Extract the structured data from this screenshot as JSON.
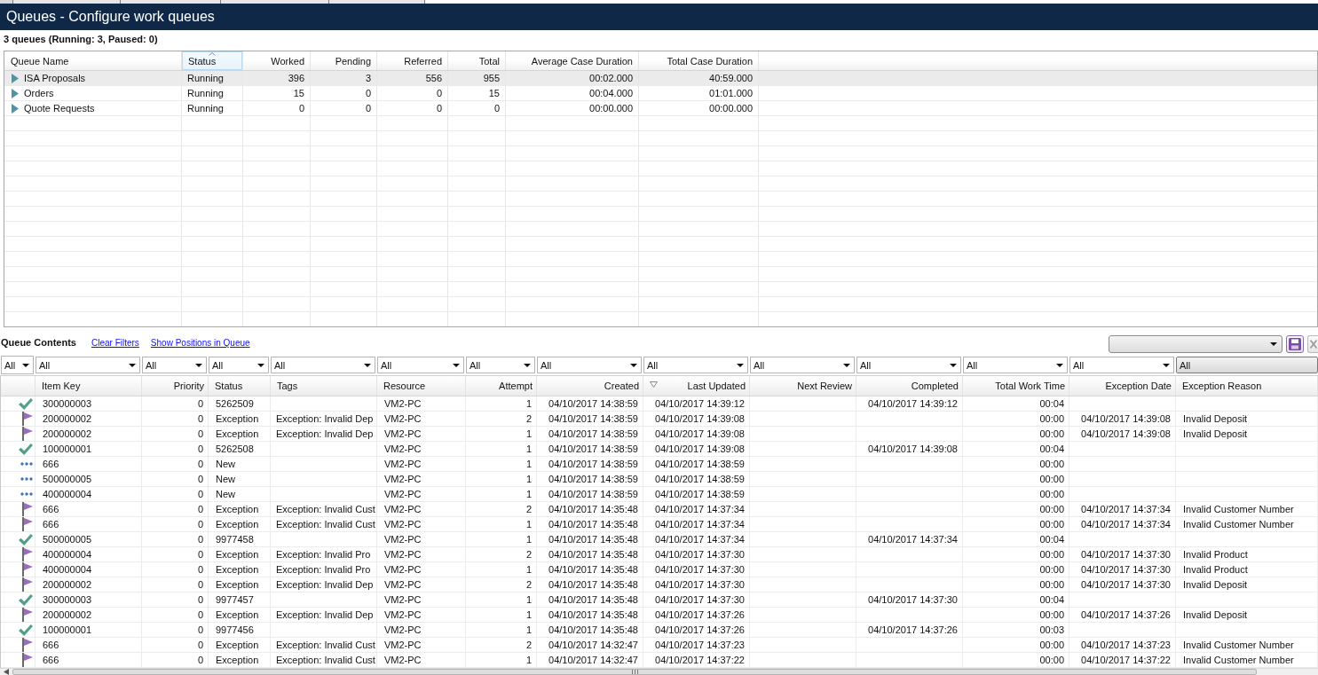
{
  "window": {
    "title": "Queues - Configure work queues"
  },
  "summary": "3 queues (Running: 3, Paused: 0)",
  "queues_table": {
    "columns": [
      {
        "label": "Queue Name",
        "kind": "text",
        "sort_ascending": false,
        "sort_descending": false
      },
      {
        "label": "Status",
        "kind": "text",
        "sort_ascending": true,
        "sort_descending": false
      },
      {
        "label": "Worked",
        "kind": "number",
        "sort_ascending": false,
        "sort_descending": false
      },
      {
        "label": "Pending",
        "kind": "number",
        "sort_ascending": false,
        "sort_descending": false
      },
      {
        "label": "Referred",
        "kind": "number",
        "sort_ascending": false,
        "sort_descending": false
      },
      {
        "label": "Total",
        "kind": "number",
        "sort_ascending": false,
        "sort_descending": false
      },
      {
        "label": "Average Case Duration",
        "kind": "time",
        "sort_ascending": false,
        "sort_descending": false
      },
      {
        "label": "Total Case Duration",
        "kind": "time",
        "sort_ascending": false,
        "sort_descending": false
      }
    ],
    "rows": [
      {
        "selected": true,
        "expanded": false,
        "cells": [
          "ISA Proposals",
          "Running",
          "396",
          "3",
          "556",
          "955",
          "00:02.000",
          "40:59.000"
        ]
      },
      {
        "selected": false,
        "expanded": false,
        "cells": [
          "Orders",
          "Running",
          "15",
          "0",
          "0",
          "15",
          "00:04.000",
          "01:01.000"
        ]
      },
      {
        "selected": false,
        "expanded": false,
        "cells": [
          "Quote Requests",
          "Running",
          "0",
          "0",
          "0",
          "0",
          "00:00.000",
          "00:00.000"
        ]
      }
    ]
  },
  "queue_contents": {
    "title": "Queue Contents",
    "links": [
      "Clear Filters",
      "Show Positions in Queue"
    ],
    "filters": [
      {
        "value": "All",
        "focused": false
      },
      {
        "value": "All",
        "focused": false
      },
      {
        "value": "All",
        "focused": false
      },
      {
        "value": "All",
        "focused": false
      },
      {
        "value": "All",
        "focused": false
      },
      {
        "value": "All",
        "focused": false
      },
      {
        "value": "All",
        "focused": false
      },
      {
        "value": "All",
        "focused": false
      },
      {
        "value": "All",
        "focused": false
      },
      {
        "value": "All",
        "focused": false
      },
      {
        "value": "All",
        "focused": false
      },
      {
        "value": "All",
        "focused": false
      },
      {
        "value": "All",
        "focused": false
      },
      {
        "value": "All",
        "focused": true
      }
    ],
    "columns": [
      {
        "label": "Item Key",
        "kind": "text",
        "sort_ascending": false,
        "sort_descending": false
      },
      {
        "label": "Priority",
        "kind": "number",
        "sort_ascending": false,
        "sort_descending": false
      },
      {
        "label": "Status",
        "kind": "text",
        "sort_ascending": false,
        "sort_descending": false
      },
      {
        "label": "Tags",
        "kind": "text",
        "sort_ascending": false,
        "sort_descending": false
      },
      {
        "label": "Resource",
        "kind": "text",
        "sort_ascending": false,
        "sort_descending": false
      },
      {
        "label": "Attempt",
        "kind": "number",
        "sort_ascending": false,
        "sort_descending": false
      },
      {
        "label": "Created",
        "kind": "date",
        "sort_ascending": false,
        "sort_descending": false
      },
      {
        "label": "Last Updated",
        "kind": "date",
        "sort_ascending": false,
        "sort_descending": true
      },
      {
        "label": "Next Review",
        "kind": "date",
        "sort_ascending": false,
        "sort_descending": false
      },
      {
        "label": "Completed",
        "kind": "date",
        "sort_ascending": false,
        "sort_descending": false
      },
      {
        "label": "Total Work Time",
        "kind": "time",
        "sort_ascending": false,
        "sort_descending": false
      },
      {
        "label": "Exception Date",
        "kind": "date",
        "sort_ascending": false,
        "sort_descending": false
      },
      {
        "label": "Exception Reason",
        "kind": "text",
        "sort_ascending": false,
        "sort_descending": false
      }
    ],
    "rows": [
      {
        "kind": "done",
        "item_key": "300000003",
        "priority": "0",
        "status": "5262509",
        "resource": "VM2-PC",
        "attempt": "1",
        "created": "04/10/2017 14:38:59",
        "last_updated": "04/10/2017 14:39:12",
        "completed": "04/10/2017 14:39:12",
        "total_work_time": "00:04"
      },
      {
        "kind": "exception",
        "item_key": "200000002",
        "priority": "0",
        "status": "Exception",
        "tags": "Exception: Invalid Dep",
        "resource": "VM2-PC",
        "attempt": "2",
        "created": "04/10/2017 14:38:59",
        "last_updated": "04/10/2017 14:39:08",
        "total_work_time": "00:00",
        "exception_date": "04/10/2017 14:39:08",
        "exception_reason": "Invalid Deposit"
      },
      {
        "kind": "exception",
        "item_key": "200000002",
        "priority": "0",
        "status": "Exception",
        "tags": "Exception: Invalid Dep",
        "resource": "VM2-PC",
        "attempt": "1",
        "created": "04/10/2017 14:38:59",
        "last_updated": "04/10/2017 14:39:08",
        "total_work_time": "00:00",
        "exception_date": "04/10/2017 14:39:08",
        "exception_reason": "Invalid Deposit"
      },
      {
        "kind": "done",
        "item_key": "100000001",
        "priority": "0",
        "status": "5262508",
        "resource": "VM2-PC",
        "attempt": "1",
        "created": "04/10/2017 14:38:59",
        "last_updated": "04/10/2017 14:39:08",
        "completed": "04/10/2017 14:39:08",
        "total_work_time": "00:04"
      },
      {
        "kind": "pending",
        "item_key": "666",
        "priority": "0",
        "status": "New",
        "resource": "VM2-PC",
        "attempt": "1",
        "created": "04/10/2017 14:38:59",
        "last_updated": "04/10/2017 14:38:59",
        "total_work_time": "00:00"
      },
      {
        "kind": "pending",
        "item_key": "500000005",
        "priority": "0",
        "status": "New",
        "resource": "VM2-PC",
        "attempt": "1",
        "created": "04/10/2017 14:38:59",
        "last_updated": "04/10/2017 14:38:59",
        "total_work_time": "00:00"
      },
      {
        "kind": "pending",
        "item_key": "400000004",
        "priority": "0",
        "status": "New",
        "resource": "VM2-PC",
        "attempt": "1",
        "created": "04/10/2017 14:38:59",
        "last_updated": "04/10/2017 14:38:59",
        "total_work_time": "00:00"
      },
      {
        "kind": "exception",
        "item_key": "666",
        "priority": "0",
        "status": "Exception",
        "tags": "Exception: Invalid Cust",
        "resource": "VM2-PC",
        "attempt": "2",
        "created": "04/10/2017 14:35:48",
        "last_updated": "04/10/2017 14:37:34",
        "total_work_time": "00:00",
        "exception_date": "04/10/2017 14:37:34",
        "exception_reason": "Invalid Customer Number"
      },
      {
        "kind": "exception",
        "item_key": "666",
        "priority": "0",
        "status": "Exception",
        "tags": "Exception: Invalid Cust",
        "resource": "VM2-PC",
        "attempt": "1",
        "created": "04/10/2017 14:35:48",
        "last_updated": "04/10/2017 14:37:34",
        "total_work_time": "00:00",
        "exception_date": "04/10/2017 14:37:34",
        "exception_reason": "Invalid Customer Number"
      },
      {
        "kind": "done",
        "item_key": "500000005",
        "priority": "0",
        "status": "9977458",
        "resource": "VM2-PC",
        "attempt": "1",
        "created": "04/10/2017 14:35:48",
        "last_updated": "04/10/2017 14:37:34",
        "completed": "04/10/2017 14:37:34",
        "total_work_time": "00:04"
      },
      {
        "kind": "exception",
        "item_key": "400000004",
        "priority": "0",
        "status": "Exception",
        "tags": "Exception: Invalid Pro",
        "resource": "VM2-PC",
        "attempt": "2",
        "created": "04/10/2017 14:35:48",
        "last_updated": "04/10/2017 14:37:30",
        "total_work_time": "00:00",
        "exception_date": "04/10/2017 14:37:30",
        "exception_reason": "Invalid Product"
      },
      {
        "kind": "exception",
        "item_key": "400000004",
        "priority": "0",
        "status": "Exception",
        "tags": "Exception: Invalid Pro",
        "resource": "VM2-PC",
        "attempt": "1",
        "created": "04/10/2017 14:35:48",
        "last_updated": "04/10/2017 14:37:30",
        "total_work_time": "00:00",
        "exception_date": "04/10/2017 14:37:30",
        "exception_reason": "Invalid Product"
      },
      {
        "kind": "exception",
        "item_key": "200000002",
        "priority": "0",
        "status": "Exception",
        "tags": "Exception: Invalid Dep",
        "resource": "VM2-PC",
        "attempt": "2",
        "created": "04/10/2017 14:35:48",
        "last_updated": "04/10/2017 14:37:30",
        "total_work_time": "00:00",
        "exception_date": "04/10/2017 14:37:30",
        "exception_reason": "Invalid Deposit"
      },
      {
        "kind": "done",
        "item_key": "300000003",
        "priority": "0",
        "status": "9977457",
        "resource": "VM2-PC",
        "attempt": "1",
        "created": "04/10/2017 14:35:48",
        "last_updated": "04/10/2017 14:37:30",
        "completed": "04/10/2017 14:37:30",
        "total_work_time": "00:04"
      },
      {
        "kind": "exception",
        "item_key": "200000002",
        "priority": "0",
        "status": "Exception",
        "tags": "Exception: Invalid Dep",
        "resource": "VM2-PC",
        "attempt": "1",
        "created": "04/10/2017 14:35:48",
        "last_updated": "04/10/2017 14:37:26",
        "total_work_time": "00:00",
        "exception_date": "04/10/2017 14:37:26",
        "exception_reason": "Invalid Deposit"
      },
      {
        "kind": "done",
        "item_key": "100000001",
        "priority": "0",
        "status": "9977456",
        "resource": "VM2-PC",
        "attempt": "1",
        "created": "04/10/2017 14:35:48",
        "last_updated": "04/10/2017 14:37:26",
        "completed": "04/10/2017 14:37:26",
        "total_work_time": "00:03"
      },
      {
        "kind": "exception",
        "item_key": "666",
        "priority": "0",
        "status": "Exception",
        "tags": "Exception: Invalid Cust",
        "resource": "VM2-PC",
        "attempt": "2",
        "created": "04/10/2017 14:32:47",
        "last_updated": "04/10/2017 14:37:23",
        "total_work_time": "00:00",
        "exception_date": "04/10/2017 14:37:23",
        "exception_reason": "Invalid Customer Number"
      },
      {
        "kind": "exception",
        "item_key": "666",
        "priority": "0",
        "status": "Exception",
        "tags": "Exception: Invalid Cust",
        "resource": "VM2-PC",
        "attempt": "1",
        "created": "04/10/2017 14:32:47",
        "last_updated": "04/10/2017 14:37:22",
        "total_work_time": "00:00",
        "exception_date": "04/10/2017 14:37:22",
        "exception_reason": "Invalid Customer Number"
      }
    ]
  }
}
